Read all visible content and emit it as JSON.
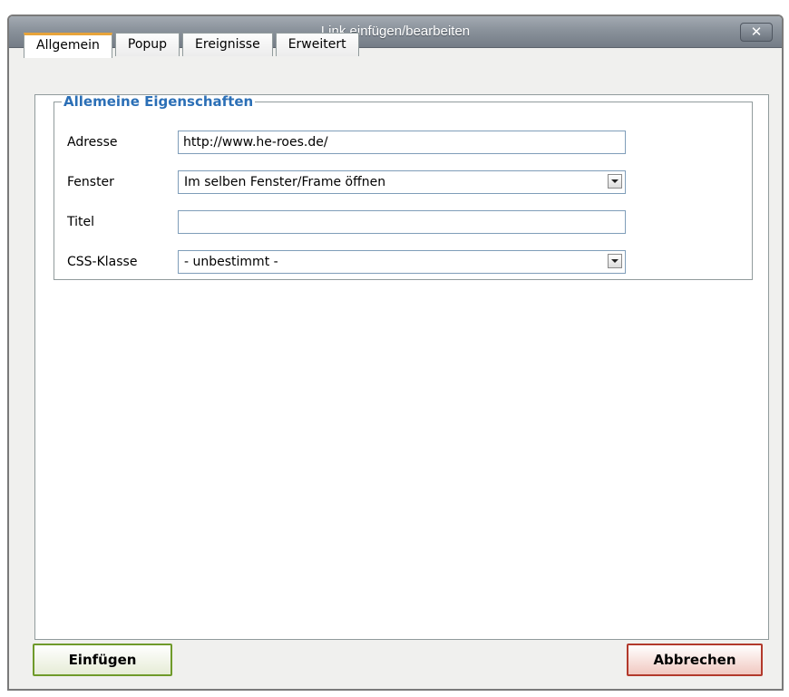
{
  "dialog": {
    "title": "Link einfügen/bearbeiten",
    "close_icon": "close-icon",
    "close_label": "✕"
  },
  "tabs": [
    {
      "label": "Allgemein",
      "active": true
    },
    {
      "label": "Popup",
      "active": false
    },
    {
      "label": "Ereignisse",
      "active": false
    },
    {
      "label": "Erweitert",
      "active": false
    }
  ],
  "section": {
    "legend": "Allemeine Eigenschaften",
    "fields": {
      "address": {
        "label": "Adresse",
        "value": "http://www.he-roes.de/"
      },
      "window": {
        "label": "Fenster",
        "selected": "Im selben Fenster/Frame öffnen"
      },
      "title": {
        "label": "Titel",
        "value": ""
      },
      "css_class": {
        "label": "CSS-Klasse",
        "selected": "- unbestimmt -"
      }
    }
  },
  "buttons": {
    "insert": "Einfügen",
    "cancel": "Abbrechen"
  },
  "colors": {
    "legend": "#2b6fb6",
    "active_tab_accent": "#e8a43a",
    "insert_border": "#6f9a2a",
    "cancel_border": "#b2392b"
  }
}
